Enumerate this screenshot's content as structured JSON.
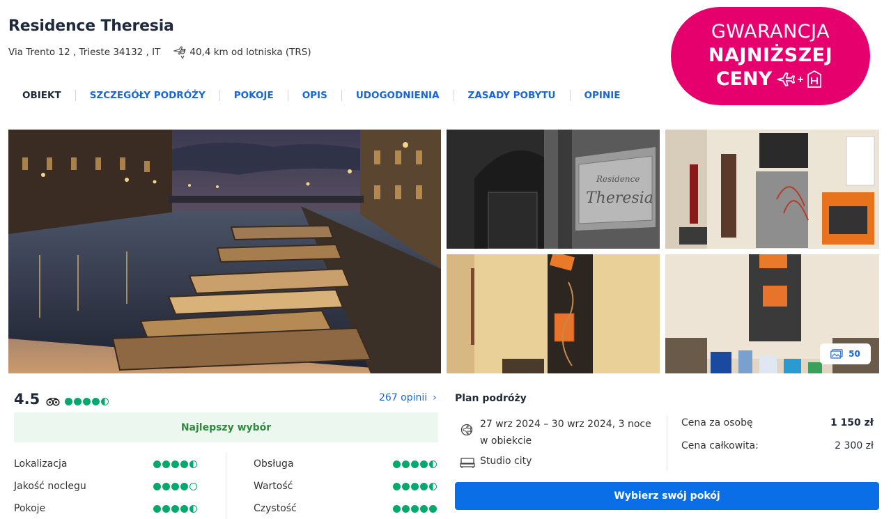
{
  "hotel": {
    "name": "Residence Theresia",
    "address": "Via Trento 12 , Trieste 34132 , IT",
    "airport_distance": "40,4 km od lotniska (TRS)"
  },
  "nav": {
    "tabs": [
      {
        "label": "OBIEKT",
        "active": true
      },
      {
        "label": "SZCZEGÓŁY PODRÓŻY"
      },
      {
        "label": "POKOJE"
      },
      {
        "label": "OPIS"
      },
      {
        "label": "UDOGODNIENIA"
      },
      {
        "label": "ZASADY POBYTU"
      },
      {
        "label": "OPINIE"
      }
    ]
  },
  "badge": {
    "line1": "GWARANCJA",
    "line2": "NAJNIŻSZEJ",
    "line3": "CENY",
    "color": "#e6006e"
  },
  "gallery": {
    "photo_count": "50"
  },
  "rating": {
    "score": "4.5",
    "bubbles": 4.5,
    "reviews_link": "267 opinii",
    "best_choice": "Najlepszy wybór",
    "sub_ratings": [
      {
        "label": "Lokalizacja",
        "value": 4.5
      },
      {
        "label": "Jakość noclegu",
        "value": 4
      },
      {
        "label": "Pokoje",
        "value": 4.5
      },
      {
        "label": "Obsługa",
        "value": 4.5
      },
      {
        "label": "Wartość",
        "value": 4.5
      },
      {
        "label": "Czystość",
        "value": 5
      }
    ]
  },
  "plan": {
    "title": "Plan podróży",
    "dates": "27 wrz 2024 – 30 wrz 2024, 3 noce w obiekcie",
    "room": "Studio city",
    "price_per_person_label": "Cena za osobę",
    "price_per_person": "1 150 zł",
    "price_total_label": "Cena całkowita:",
    "price_total": "2 300 zł",
    "cta": "Wybierz swój pokój"
  },
  "colors": {
    "accent": "#0a6ee6",
    "link": "#1a66d6",
    "tripadvisor_green": "#00aa6c"
  }
}
